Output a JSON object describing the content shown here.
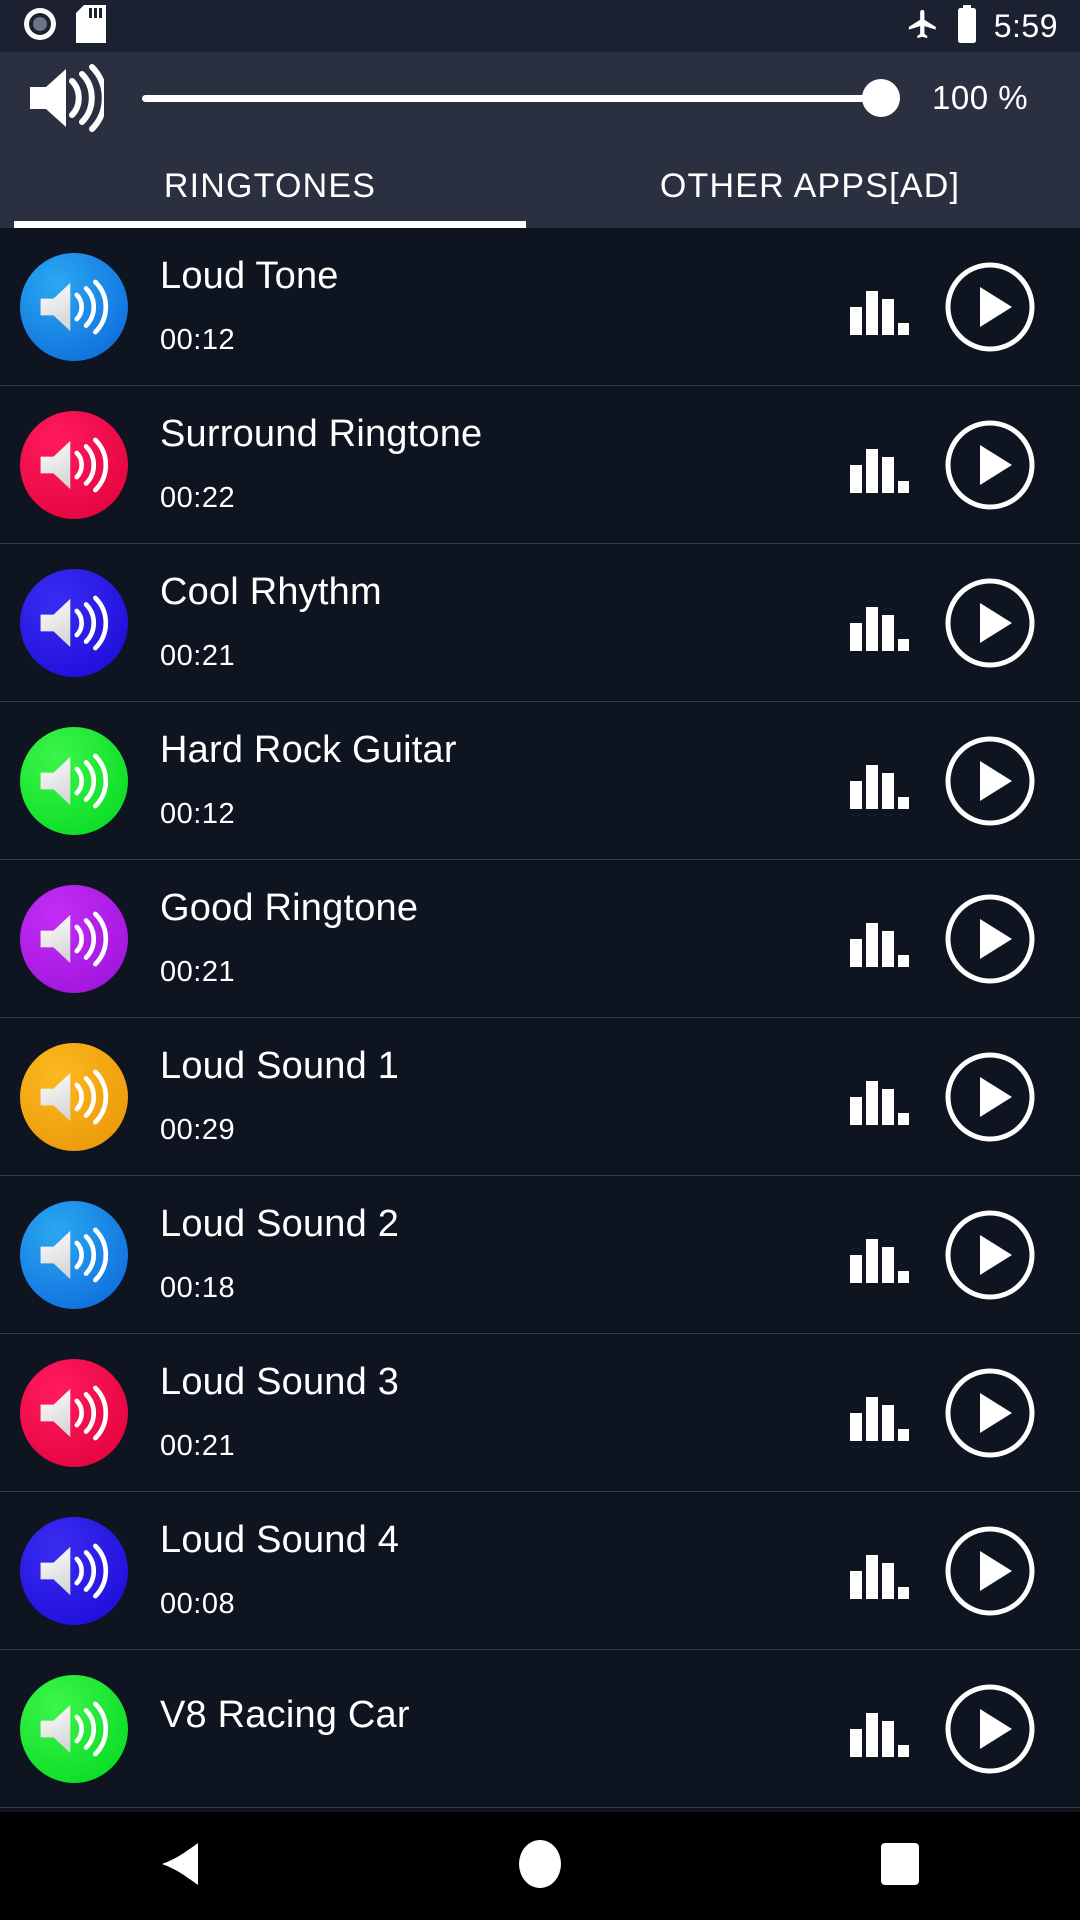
{
  "statusbar": {
    "time": "5:59",
    "icons": [
      "camera-recording-icon",
      "sd-card-icon",
      "airplane-mode-icon",
      "battery-full-icon"
    ]
  },
  "volume": {
    "icon": "speaker-volume-icon",
    "percent_label": "100 %",
    "value": 100
  },
  "tabs": [
    {
      "label": "RINGTONES",
      "active": true
    },
    {
      "label": "OTHER APPS[AD]",
      "active": false
    }
  ],
  "colors": {
    "status_bg": "#1b2130",
    "header_bg": "#2b3040",
    "list_bg": "#0e1420",
    "divider": "#333a48",
    "accent": "#ffffff",
    "navbar_bg": "#000000"
  },
  "ringtones": [
    {
      "title": "Loud Tone",
      "duration": "00:12",
      "color_start": "#2aa8f2",
      "color_end": "#0a64d8",
      "color": "#1286ea"
    },
    {
      "title": "Surround Ringtone",
      "duration": "00:22",
      "color_start": "#ff1a5e",
      "color_end": "#e00038",
      "color": "#f20d4a"
    },
    {
      "title": "Cool Rhythm",
      "duration": "00:21",
      "color_start": "#3a2df0",
      "color_end": "#1a08d8",
      "color": "#2a18e8"
    },
    {
      "title": "Hard Rock Guitar",
      "duration": "00:12",
      "color_start": "#3cf54a",
      "color_end": "#00d81e",
      "color": "#1ae636"
    },
    {
      "title": "Good Ringtone",
      "duration": "00:21",
      "color_start": "#c42df5",
      "color_end": "#9a10d8",
      "color": "#b026e8"
    },
    {
      "title": "Loud Sound 1",
      "duration": "00:29",
      "color_start": "#fcb91e",
      "color_end": "#e89306",
      "color": "#f5a81c"
    },
    {
      "title": "Loud Sound 2",
      "duration": "00:18",
      "color_start": "#2aa8f2",
      "color_end": "#0a64d8",
      "color": "#1286ea"
    },
    {
      "title": "Loud Sound 3",
      "duration": "00:21",
      "color_start": "#ff1a5e",
      "color_end": "#e00038",
      "color": "#f20d4a"
    },
    {
      "title": "Loud Sound 4",
      "duration": "00:08",
      "color_start": "#3a2df0",
      "color_end": "#1a08d8",
      "color": "#2a18e8"
    },
    {
      "title": "V8 Racing Car",
      "duration": "",
      "color_start": "#3cf54a",
      "color_end": "#00d81e",
      "color": "#1ae636"
    }
  ],
  "row_controls": {
    "equalizer_icon": "equalizer-icon",
    "play_icon": "play-circle-icon"
  },
  "navbar": {
    "back": "back-triangle-icon",
    "home": "home-circle-icon",
    "recents": "recents-square-icon"
  }
}
